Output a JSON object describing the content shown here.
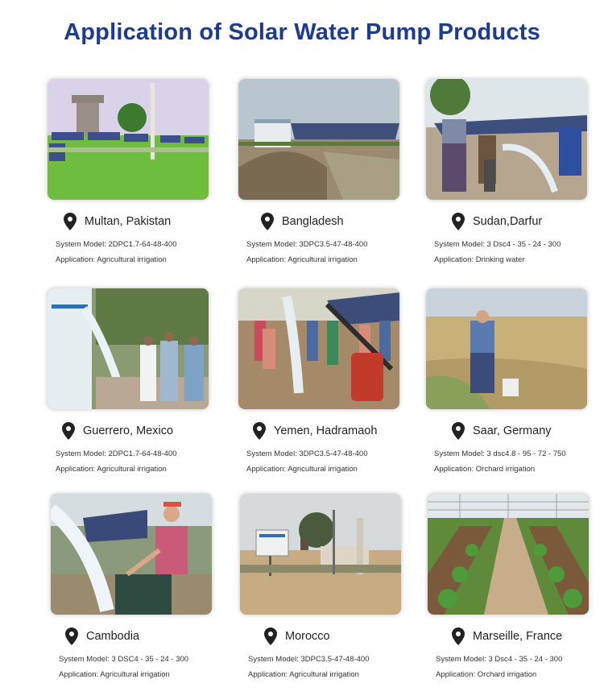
{
  "title": "Application of Solar Water Pump Products",
  "labels": {
    "model": "System Model: ",
    "application": "Application: "
  },
  "cards": [
    {
      "location": "Multan, Pakistan",
      "model": "2DPC1.7-64-48-400",
      "application": "Agricultural irrigation"
    },
    {
      "location": "Bangladesh",
      "model": "3DPC3.5-47-48-400",
      "application": "Agricultural irrigation"
    },
    {
      "location": "Sudan,Darfur",
      "model": "3 Dsc4 - 35 - 24 - 300",
      "application": "Drinking water"
    },
    {
      "location": "Guerrero, Mexico",
      "model": "2DPC1.7-64-48-400",
      "application": "Agricultural irrigation"
    },
    {
      "location": "Yemen, Hadramaoh",
      "model": "3DPC3.5-47-48-400",
      "application": "Agricultural irrigation"
    },
    {
      "location": "Saar, Germany",
      "model": "3 dsc4.8 - 95 - 72 - 750",
      "application": "Orchard irrigation"
    },
    {
      "location": "Cambodia",
      "model": "3 DSC4 - 35 - 24 - 300",
      "application": "Agricultural irrigation"
    },
    {
      "location": "Morocco",
      "model": "3DPC3.5-47-48-400",
      "application": "Agricultural irrigation"
    },
    {
      "location": "Marseille, France",
      "model": "3 Dsc4 - 35 - 24 - 300",
      "application": "Orchard irrigation"
    }
  ],
  "colors": {
    "title": "#1d3b8f",
    "pin": "#222222",
    "text": "#333333"
  },
  "icons": {
    "location": "map-pin-icon"
  }
}
